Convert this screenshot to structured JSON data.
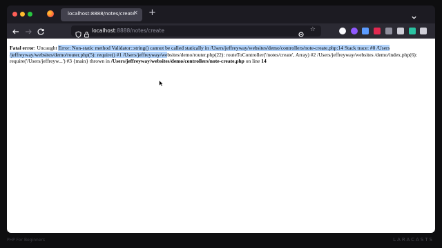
{
  "browser": {
    "tab_title": "localhost:8888/notes/create",
    "tab_close": "×",
    "new_tab": "+",
    "url_host": "localhost",
    "url_path": ":8888/notes/create",
    "bookmark_star": "☆"
  },
  "error": {
    "label": "Fatal error",
    "sep": ": ",
    "uncaught": "Uncaught ",
    "selected_1": "Error: Non-static method Validator::string() cannot be called statically in /Users/jeffreyway/websites/demo/controllers/note-create.php:14 Stack trace: #0 /Users /jeffreyway/websites/demo/router.php(5): require() #1 /Users/jeffreyway/we",
    "rest_1": "bsites/demo/router.php(22): routeToController('/notes/create', Array) #2 /Users/jeffreyway/websites /demo/index.php(6): require('/Users/jeffreyw...') #3 {main} thrown in ",
    "file": "/Users/jeffreyway/websites/demo/controllers/note-create.php",
    "on_line": " on line ",
    "line": "14"
  },
  "footer": {
    "course": "PHP For Beginners",
    "brand": "LARACASTS"
  },
  "colors": {
    "selection": "#b3d4fc",
    "chrome": "#1c1b22",
    "toolbar": "#2b2a33"
  }
}
